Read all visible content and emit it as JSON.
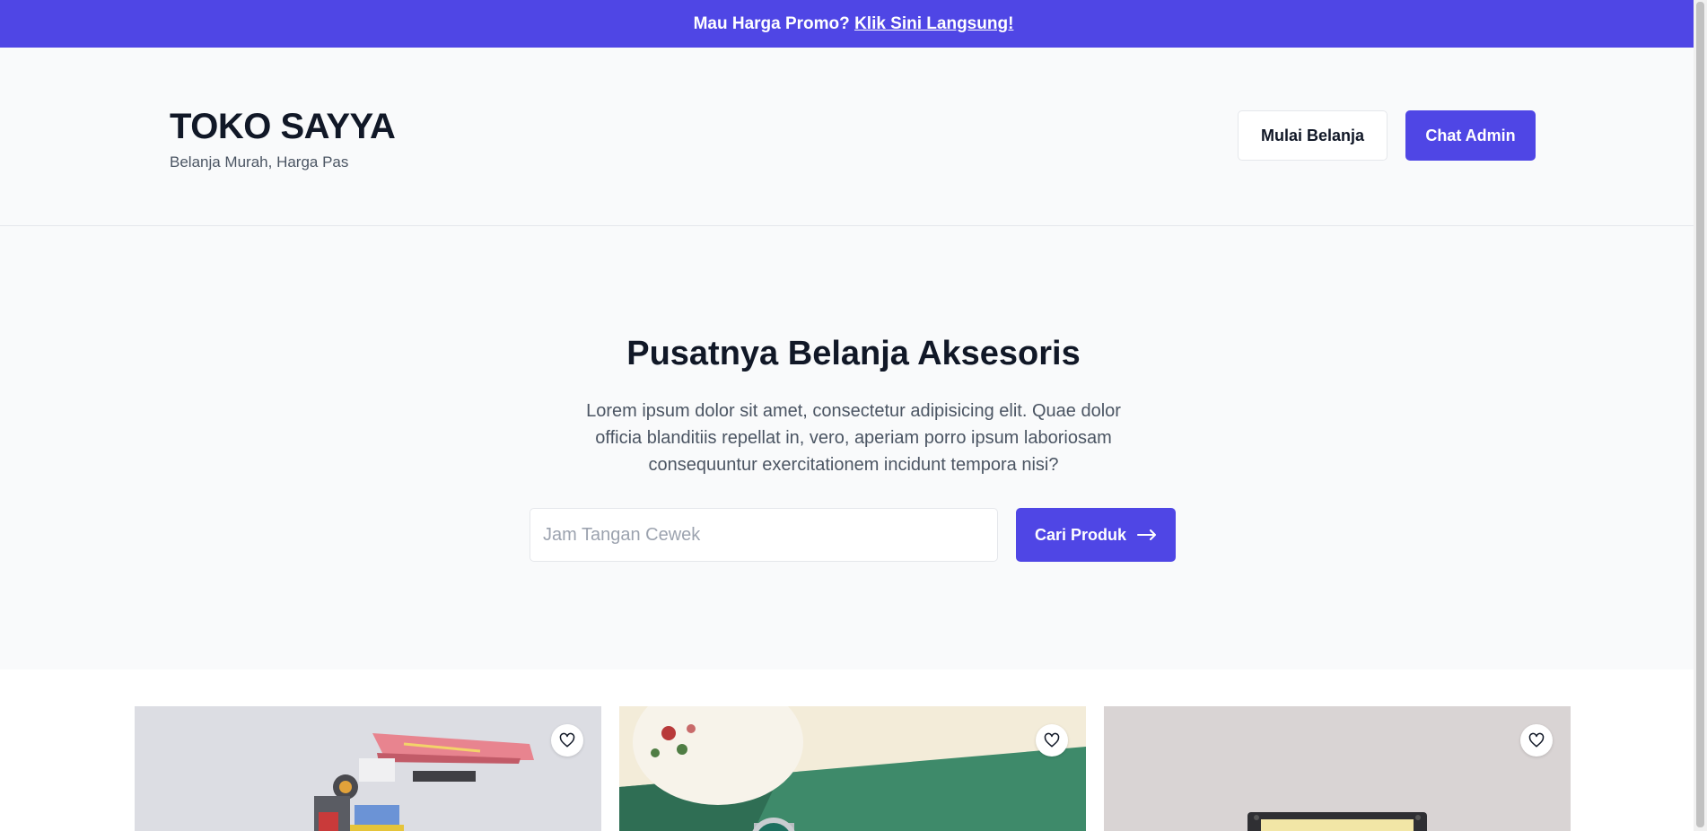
{
  "promo": {
    "text": "Mau Harga Promo?",
    "link": "Klik Sini Langsung!"
  },
  "header": {
    "brand": "TOKO SAYYA",
    "tagline": "Belanja Murah, Harga Pas",
    "shop_button": "Mulai Belanja",
    "chat_button": "Chat Admin"
  },
  "hero": {
    "title": "Pusatnya Belanja Aksesoris",
    "description": "Lorem ipsum dolor sit amet, consectetur adipisicing elit. Quae dolor officia blanditiis repellat in, vero, aperiam porro ipsum laboriosam consequuntur exercitationem incidunt tempora nisi?",
    "search_placeholder": "Jam Tangan Cewek",
    "search_button": "Cari Produk"
  },
  "products": [
    {
      "image": "gundam-robot-figure",
      "wishlist_icon": "heart-icon"
    },
    {
      "image": "green-dial-wristwatch",
      "wishlist_icon": "heart-icon"
    },
    {
      "image": "retro-gadget-on-grey",
      "wishlist_icon": "heart-icon"
    }
  ],
  "colors": {
    "accent": "#4f46e5",
    "header_bg": "#f9fafb",
    "text_dark": "#111827",
    "text_muted": "#4b5563"
  }
}
